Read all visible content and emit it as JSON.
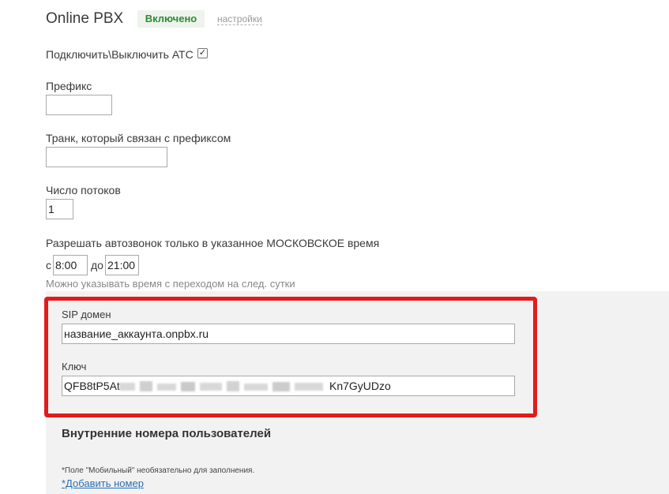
{
  "header": {
    "title": "Online PBX",
    "status": "Включено",
    "settings_link": "настройки"
  },
  "toggle": {
    "label": "Подключить\\Выключить АТС",
    "checked": true
  },
  "prefix": {
    "label": "Префикс",
    "value": ""
  },
  "trunk": {
    "label": "Транк, который связан с префиксом",
    "value": ""
  },
  "threads": {
    "label": "Число потоков",
    "value": "1"
  },
  "time": {
    "label": "Разрешать автозвонок только в указанное МОСКОВСКОЕ время",
    "from_label": "с",
    "from_value": "8:00",
    "to_label": "до",
    "to_value": "21:00",
    "hint": "Можно указывать время с переходом на след. сутки"
  },
  "sip": {
    "domain_label": "SIP домен",
    "domain_value": "название_аккаунта.onpbx.ru",
    "key_label": "Ключ",
    "key_prefix": "QFB8tP5At",
    "key_suffix": "Kn7GyUDzo"
  },
  "internal": {
    "title": "Внутренние номера пользователей",
    "footnote": "*Поле \"Мобильный\" необязательно для заполнения.",
    "add_link": "*Добавить номер"
  },
  "colors": {
    "status_green": "#2f8a2f",
    "highlight_red": "#e21b1b",
    "link_blue": "#2a6fb5"
  }
}
